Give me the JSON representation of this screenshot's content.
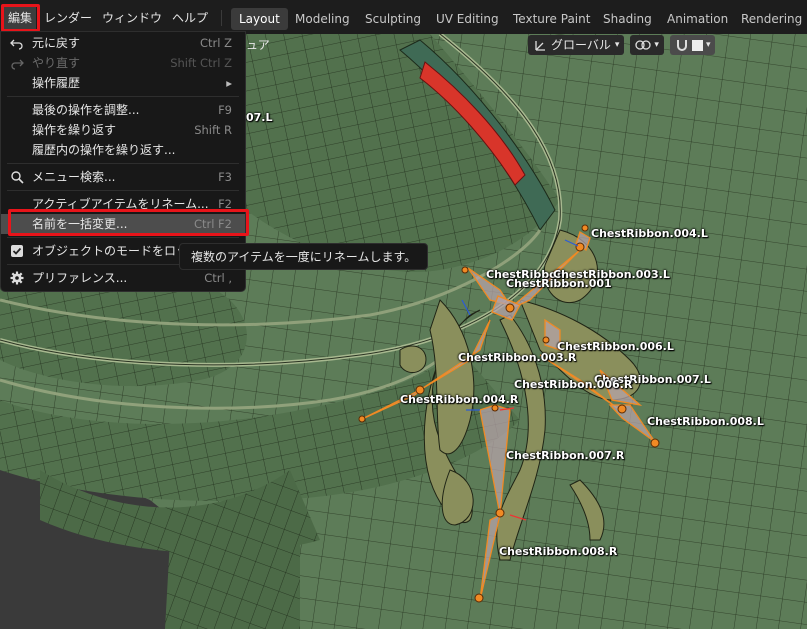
{
  "top_menus": [
    "編集",
    "レンダー",
    "ウィンドウ",
    "ヘルプ"
  ],
  "workspace_tabs": [
    "Layout",
    "Modeling",
    "Sculpting",
    "UV Editing",
    "Texture Paint",
    "Shading",
    "Animation",
    "Rendering"
  ],
  "active_workspace": "Layout",
  "viewport_header": {
    "transform_orientation": "グローバル",
    "partial_menu_text": "ュア",
    "partial_overlay_label": "07.L"
  },
  "edit_menu": {
    "items": [
      {
        "label": "元に戻す",
        "shortcut": "Ctrl Z",
        "icon": "undo-icon"
      },
      {
        "label": "やり直す",
        "shortcut": "Shift Ctrl Z",
        "icon": "redo-icon",
        "disabled": true
      },
      {
        "label": "操作履歴",
        "shortcut": "",
        "submenu": true
      },
      {
        "label": "最後の操作を調整...",
        "shortcut": "F9"
      },
      {
        "label": "操作を繰り返す",
        "shortcut": "Shift R"
      },
      {
        "label": "履歴内の操作を繰り返す...",
        "shortcut": ""
      },
      {
        "label": "メニュー検索...",
        "shortcut": "F3",
        "icon": "search-icon"
      },
      {
        "label": "アクティブアイテムをリネーム...",
        "shortcut": "F2"
      },
      {
        "label": "名前を一括変更...",
        "shortcut": "Ctrl F2",
        "highlighted": true
      },
      {
        "label": "オブジェクトのモードをロック",
        "shortcut": "",
        "icon": "checkbox-icon"
      },
      {
        "label": "プリファレンス...",
        "shortcut": "Ctrl ,",
        "icon": "gear-icon"
      }
    ],
    "submenu_arrow": "▸",
    "tooltip": "複数のアイテムを一度にリネームします。"
  },
  "bone_labels": [
    "ChestRibbon.004.L",
    "ChestRibbon",
    "ChestRibbon.003.L",
    "ChestRibbon.001",
    "ChestRibbon.006.L",
    "ChestRibbon.003.R",
    "ChestRibbon.007.L",
    "ChestRibbon.006.R",
    "ChestRibbon.004.R",
    "ChestRibbon.008.L",
    "ChestRibbon.007.R",
    "ChestRibbon.008.R"
  ],
  "colors": {
    "accent_red": "#e8141a",
    "mesh_green": "#5a7a55",
    "bone_orange": "#f08a24",
    "menu_bg": "#181818"
  }
}
